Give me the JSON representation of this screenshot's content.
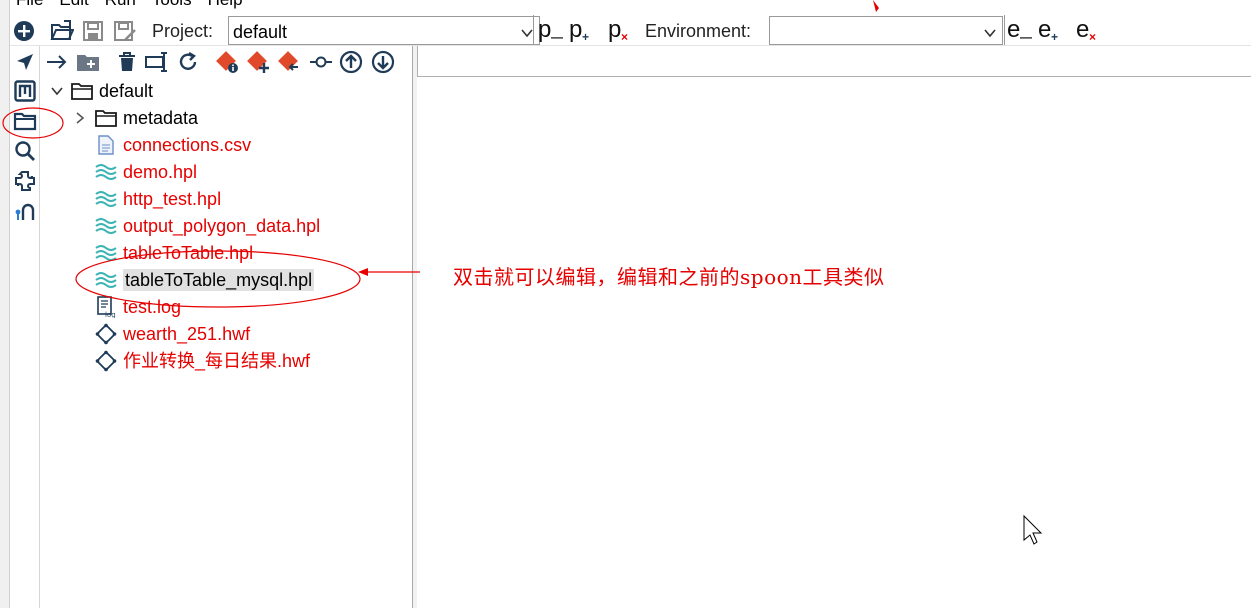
{
  "menu": [
    "File",
    "Edit",
    "Run",
    "Tools",
    "Help"
  ],
  "toolbar": {
    "project_label": "Project:",
    "project_value": "default",
    "environment_label": "Environment:",
    "environment_value": "",
    "project_buttons": [
      "p",
      "p",
      "p"
    ],
    "env_buttons": [
      "e",
      "e",
      "e"
    ]
  },
  "left_bar": {
    "icons": [
      "navigate-icon",
      "metadata-icon",
      "explorer-icon",
      "search-icon",
      "plugin-icon",
      "git-icon"
    ]
  },
  "explorer": {
    "toolbar_icons": [
      "open-arrow-icon",
      "new-folder-icon",
      "delete-icon",
      "rename-icon",
      "refresh-icon",
      "git-info-icon",
      "git-add-icon",
      "git-revert-icon",
      "git-commit-icon",
      "git-push-icon",
      "git-pull-icon"
    ],
    "tree": [
      {
        "label": "default",
        "type": "folder",
        "level": 0,
        "expanded": true,
        "color": "black"
      },
      {
        "label": "metadata",
        "type": "folder",
        "level": 1,
        "expanded": false,
        "color": "black"
      },
      {
        "label": "connections.csv",
        "type": "file",
        "level": 1,
        "color": "red"
      },
      {
        "label": "demo.hpl",
        "type": "pipeline",
        "level": 1,
        "color": "red"
      },
      {
        "label": "http_test.hpl",
        "type": "pipeline",
        "level": 1,
        "color": "red"
      },
      {
        "label": "output_polygon_data.hpl",
        "type": "pipeline",
        "level": 1,
        "color": "red"
      },
      {
        "label": "tableToTable.hpl",
        "type": "pipeline",
        "level": 1,
        "color": "red"
      },
      {
        "label": "tableToTable_mysql.hpl",
        "type": "pipeline",
        "level": 1,
        "color": "black",
        "selected": true
      },
      {
        "label": "test.log",
        "type": "log",
        "level": 1,
        "color": "red"
      },
      {
        "label": "wearth_251.hwf",
        "type": "workflow",
        "level": 1,
        "color": "red"
      },
      {
        "label": "作业转换_每日结果.hwf",
        "type": "workflow",
        "level": 1,
        "color": "red"
      }
    ]
  },
  "annotation": {
    "text": "双击就可以编辑，编辑和之前的spoon工具类似",
    "color": "#e60000"
  },
  "colors": {
    "accent_red": "#e60000",
    "pipeline_teal": "#3cb4b4",
    "icon_dark": "#1f3b57",
    "git_red": "#e04a2a",
    "selection_gray": "#e1e1e1"
  }
}
